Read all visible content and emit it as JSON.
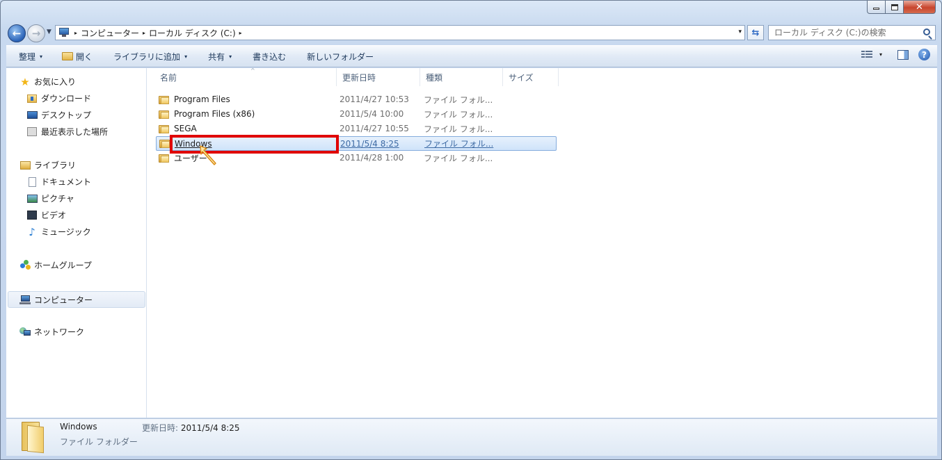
{
  "window": {
    "colors": {
      "accent": "#2a63b8",
      "highlight_box": "#e00000",
      "selection": "#cfe3fa"
    }
  },
  "caption": {
    "minimize_icon": "minimize-icon",
    "maximize_icon": "maximize-icon",
    "close_glyph": "✕"
  },
  "address": {
    "crumbs": [
      "コンピューター",
      "ローカル ディスク (C:)"
    ],
    "separator": "▸",
    "dropdown": "▾"
  },
  "search": {
    "placeholder": "ローカル ディスク (C:)の検索"
  },
  "toolbar": {
    "organize": "整理",
    "open": "開く",
    "add_to_library": "ライブラリに追加",
    "share": "共有",
    "burn": "書き込む",
    "new_folder": "新しいフォルダー",
    "caret": "▾",
    "help": "?"
  },
  "nav": {
    "favorites": "お気に入り",
    "downloads": "ダウンロード",
    "desktop": "デスクトップ",
    "recent": "最近表示した場所",
    "libraries": "ライブラリ",
    "documents": "ドキュメント",
    "pictures": "ピクチャ",
    "videos": "ビデオ",
    "music": "ミュージック",
    "homegroup": "ホームグループ",
    "computer": "コンピューター",
    "network": "ネットワーク"
  },
  "columns": {
    "name": "名前",
    "modified": "更新日時",
    "type": "種類",
    "size": "サイズ",
    "sort_indicator": "^"
  },
  "files": [
    {
      "name": "Program Files",
      "modified": "2011/4/27 10:53",
      "type": "ファイル フォル..."
    },
    {
      "name": "Program Files (x86)",
      "modified": "2011/5/4 10:00",
      "type": "ファイル フォル..."
    },
    {
      "name": "SEGA",
      "modified": "2011/4/27 10:55",
      "type": "ファイル フォル..."
    },
    {
      "name": "Windows",
      "modified": "2011/5/4 8:25",
      "type": "ファイル フォル...",
      "selected": true
    },
    {
      "name": "ユーザー",
      "modified": "2011/4/28 1:00",
      "type": "ファイル フォル..."
    }
  ],
  "details": {
    "name": "Windows",
    "type": "ファイル フォルダー",
    "modified_label": "更新日時:",
    "modified_value": "2011/5/4 8:25"
  }
}
